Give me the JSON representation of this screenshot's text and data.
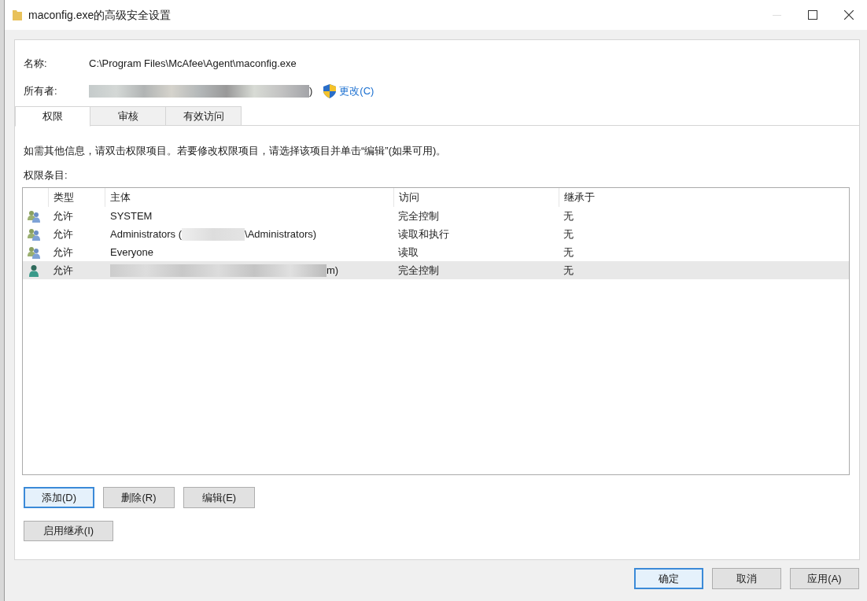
{
  "window": {
    "title": "maconfig.exe的高级安全设置"
  },
  "name_label": "名称:",
  "name_value": "C:\\Program Files\\McAfee\\Agent\\maconfig.exe",
  "owner": {
    "label": "所有者:",
    "redacted": true,
    "suffix": ")",
    "change_link": "更改(C)"
  },
  "tabs": [
    {
      "label": "权限",
      "selected": true
    },
    {
      "label": "审核",
      "selected": false
    },
    {
      "label": "有效访问",
      "selected": false
    }
  ],
  "info_text": "如需其他信息，请双击权限项目。若要修改权限项目，请选择该项目并单击“编辑”(如果可用)。",
  "entries_label": "权限条目:",
  "table": {
    "columns": [
      "类型",
      "主体",
      "访问",
      "继承于"
    ],
    "rows": [
      {
        "kind": "group",
        "type": "允许",
        "principal": "SYSTEM",
        "redacted": false,
        "suffix": "",
        "access": "完全控制",
        "inherited_from": "无",
        "selected": false
      },
      {
        "kind": "group",
        "type": "允许",
        "principal": "Administrators (",
        "redacted": true,
        "suffix": "\\Administrators)",
        "access": "读取和执行",
        "inherited_from": "无",
        "selected": false
      },
      {
        "kind": "group",
        "type": "允许",
        "principal": "Everyone",
        "redacted": false,
        "suffix": "",
        "access": "读取",
        "inherited_from": "无",
        "selected": false
      },
      {
        "kind": "user",
        "type": "允许",
        "principal": "",
        "redacted": true,
        "suffix": "m)",
        "access": "完全控制",
        "inherited_from": "无",
        "selected": true
      }
    ]
  },
  "buttons": [
    {
      "label": "添加(D)",
      "focused": true
    },
    {
      "label": "删除(R)",
      "focused": false
    },
    {
      "label": "编辑(E)",
      "focused": false
    }
  ],
  "inherit_button": "启用继承(I)",
  "dialog_buttons": [
    {
      "label": "确定",
      "focused": true
    },
    {
      "label": "取消",
      "focused": false
    },
    {
      "label": "应用(A)",
      "focused": false
    }
  ]
}
